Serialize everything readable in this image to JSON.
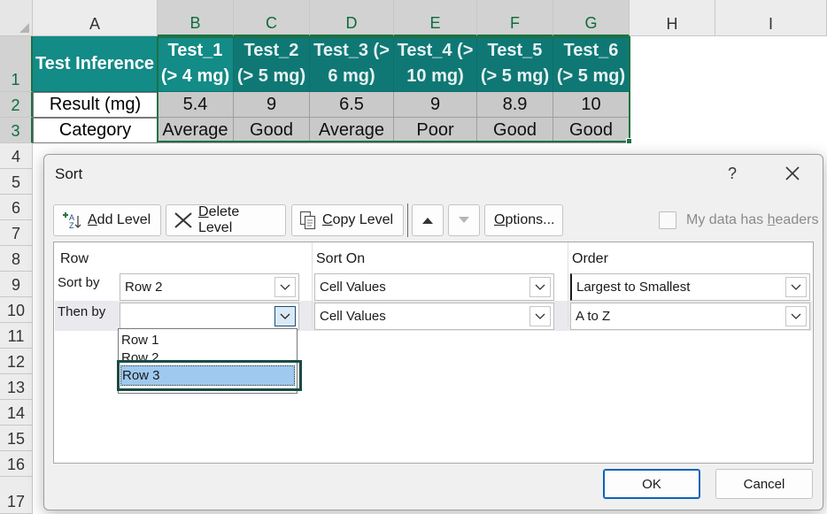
{
  "sheet": {
    "columns": [
      "A",
      "B",
      "C",
      "D",
      "E",
      "F",
      "G",
      "H",
      "I"
    ],
    "rows": [
      "1",
      "2",
      "3",
      "4",
      "5",
      "6",
      "7",
      "8",
      "9",
      "10",
      "11",
      "12",
      "13",
      "14",
      "15",
      "16",
      "17"
    ],
    "header_row": {
      "a1": "Test Inference",
      "tests": [
        {
          "line1": "Test_1",
          "line2": "(> 4 mg)"
        },
        {
          "line1": "Test_2",
          "line2": "(> 5 mg)"
        },
        {
          "line1": "Test_3 (>",
          "line2": "6 mg)"
        },
        {
          "line1": "Test_4 (>",
          "line2": "10 mg)"
        },
        {
          "line1": "Test_5",
          "line2": "(> 5 mg)"
        },
        {
          "line1": "Test_6",
          "line2": "(> 5 mg)"
        }
      ]
    },
    "result_row": {
      "label": "Result (mg)",
      "values": [
        "5.4",
        "9",
        "6.5",
        "9",
        "8.9",
        "10"
      ]
    },
    "category_row": {
      "label": "Category",
      "values": [
        "Average",
        "Good",
        "Average",
        "Poor",
        "Good",
        "Good"
      ]
    },
    "colors": {
      "header_teal": "#138b87",
      "selection_green": "#1e7145",
      "value_gray": "#c9c9c9"
    }
  },
  "dialog": {
    "title": "Sort",
    "help_label": "?",
    "close_icon": "close-icon",
    "toolbar": {
      "add_level_u": "A",
      "add_level_rest": "dd Level",
      "delete_level_u": "D",
      "delete_level_rest": "elete Level",
      "copy_level_u": "C",
      "copy_level_rest": "opy Level",
      "options_u": "O",
      "options_rest": "ptions..."
    },
    "my_data_has_headers": {
      "before": "My data has ",
      "u": "h",
      "after": "eaders",
      "checked": false
    },
    "columns": {
      "row": "Row",
      "sort_on": "Sort On",
      "order": "Order"
    },
    "levels": [
      {
        "label": "Sort by",
        "row": "Row 2",
        "sort_on": "Cell Values",
        "order": "Largest to Smallest"
      },
      {
        "label": "Then by",
        "row": "",
        "sort_on": "Cell Values",
        "order": "A to Z"
      }
    ],
    "dropdown_options": [
      "Row 1",
      "Row 2",
      "Row 3"
    ],
    "dropdown_selected": "Row 3",
    "ok_label": "OK",
    "cancel_label": "Cancel"
  }
}
